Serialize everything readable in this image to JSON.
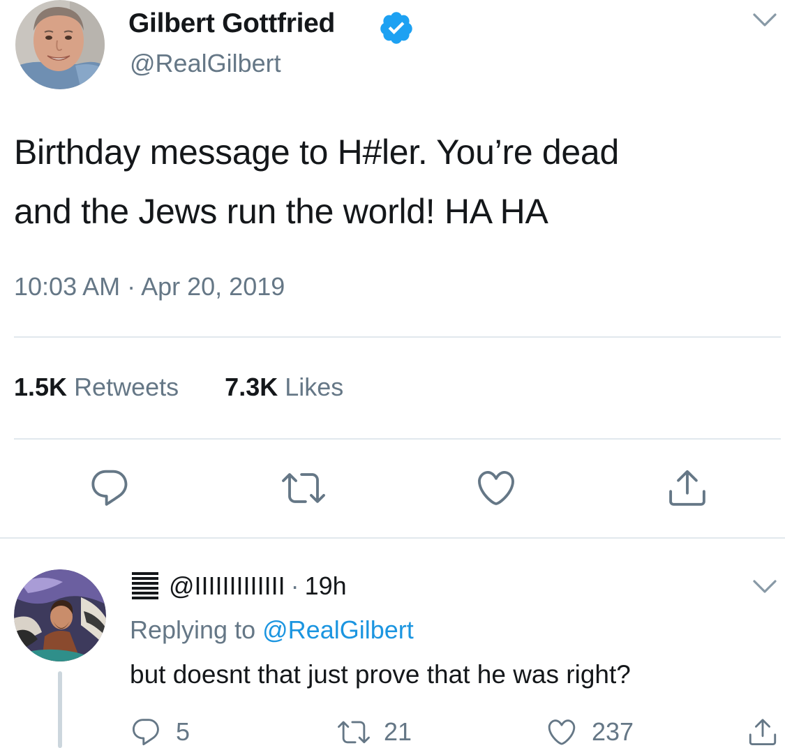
{
  "tweet": {
    "display_name": "Gilbert Gottfried",
    "handle": "@RealGilbert",
    "text_lines": [
      "Birthday message to H#ler. You’re dead",
      "and the Jews run the world! HA HA"
    ],
    "timestamp": "10:03 AM · Apr 20, 2019",
    "verified": true
  },
  "stats": {
    "retweets_count": "1.5K",
    "retweets_label": "Retweets",
    "likes_count": "7.3K",
    "likes_label": "Likes"
  },
  "actions": {
    "icons": [
      "reply-icon",
      "retweet-icon",
      "like-icon",
      "share-icon"
    ]
  },
  "reply": {
    "handle": "@IIIIIIIIIIIII",
    "separator": "·",
    "time": "19h",
    "replying_label": "Replying to",
    "replying_handle": "@RealGilbert",
    "text": "but doesnt that just prove that he was right?",
    "reply_count": "5",
    "retweet_count": "21",
    "like_count": "237"
  },
  "colors": {
    "accent": "#1da1f2",
    "link": "#1b95e0",
    "secondary_text": "#657786",
    "divider": "#e1e8ed",
    "icon": "#657786"
  }
}
